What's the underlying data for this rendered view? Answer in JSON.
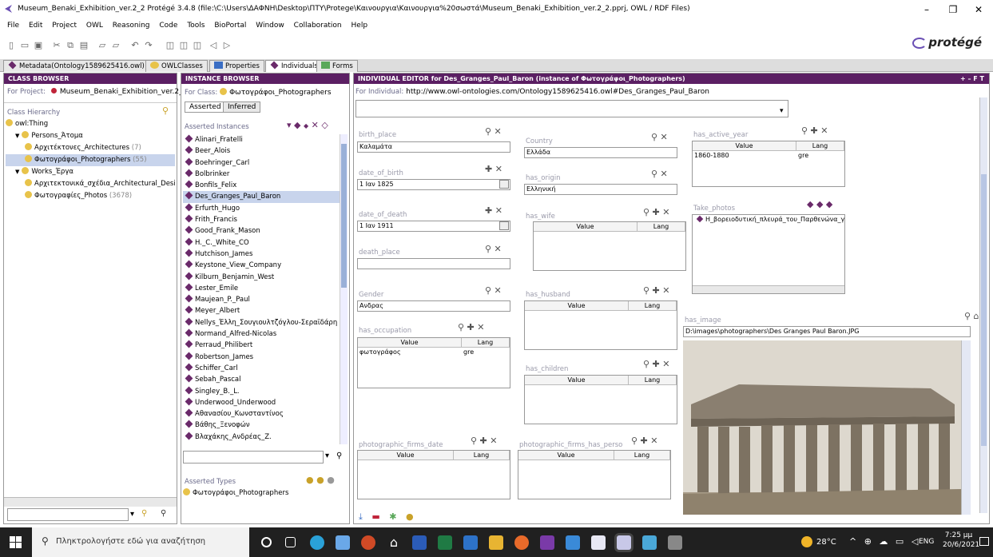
{
  "window": {
    "title": "Museum_Benaki_Exhibition_ver.2_2  Protégé 3.4.8   (file:\\C:\\Users\\ΔΑΦΝΗ\\Desktop\\ΠΤΥ\\Protege\\Καινουργια\\Καινουργια%20σωστά\\Museum_Benaki_Exhibition_ver.2_2.pprj, OWL / RDF Files)",
    "minimize": "–",
    "maximize": "❐",
    "close": "✕"
  },
  "menu": [
    "File",
    "Edit",
    "Project",
    "OWL",
    "Reasoning",
    "Code",
    "Tools",
    "BioPortal",
    "Window",
    "Collaboration",
    "Help"
  ],
  "logo": "protégé",
  "tabs": [
    "Metadata(Ontology1589625416.owl)",
    "OWLClasses",
    "Properties",
    "Individuals",
    "Forms"
  ],
  "colors": {
    "header": "#5b1f63",
    "instance": "#6a2a6a",
    "class": "#e8c34a",
    "selected": "#c8d4ec",
    "accent": "#6a4fb4"
  },
  "class_browser": {
    "header": "CLASS BROWSER",
    "project_label": "For Project:",
    "project": "Museum_Benaki_Exhibition_ver.2_2",
    "hierarchy_label": "Class Hierarchy",
    "tree": [
      {
        "label": "owl:Thing",
        "indent": 0
      },
      {
        "label": "Persons_Άτομα",
        "indent": 1,
        "arrow": "▼"
      },
      {
        "label": "Αρχιτέκτονες_Architectures",
        "count": "(7)",
        "indent": 2
      },
      {
        "label": "Φωτογράφοι_Photographers",
        "count": "(55)",
        "indent": 2,
        "selected": true
      },
      {
        "label": "Works_Έργα",
        "indent": 1,
        "arrow": "▼"
      },
      {
        "label": "Αρχιτεκτονικά_σχέδια_Architectural_Design",
        "indent": 2
      },
      {
        "label": "Φωτογραφίες_Photos",
        "count": "(3678)",
        "indent": 2
      }
    ]
  },
  "instance_browser": {
    "header": "INSTANCE BROWSER",
    "class_label": "For Class:",
    "class": "Φωτογράφοι_Photographers",
    "tab_asserted": "Asserted",
    "tab_inferred": "Inferred",
    "list_label": "Asserted Instances",
    "types_label": "Asserted Types",
    "type": "Φωτογράφοι_Photographers",
    "instances": [
      "Alinari_Fratelli",
      "Beer_Alois",
      "Boehringer_Carl",
      "Bolbrinker",
      "Bonfils_Felix",
      "Des_Granges_Paul_Baron",
      "Erfurth_Hugo",
      "Frith_Francis",
      "Good_Frank_Mason",
      "H._C._White_CO",
      "Hutchison_James",
      "Keystone_View_Company",
      "Kilburn_Benjamin_West",
      "Lester_Emile",
      "Maujean_P._Paul",
      "Meyer_Albert",
      "Nellys_Έλλη_Σουγιουλτζόγλου-Σεραϊδάρη",
      "Normand_Alfred-Nicolas",
      "Perraud_Philibert",
      "Robertson_James",
      "Schiffer_Carl",
      "Sebah_Pascal",
      "Singley_B._L.",
      "Underwood_Underwood",
      "Αθανασίου_Κωνσταντίνος",
      "Βάθης_Ξενοφών",
      "Βλαχάκης_Ανδρέας_Ζ."
    ],
    "selected_index": 5
  },
  "editor": {
    "header": "INDIVIDUAL EDITOR for Des_Granges_Paul_Baron   (instance of Φωτογράφοι_Photographers)",
    "header_controls": "+ – F T",
    "for_label": "For Individual:",
    "uri": "http://www.owl-ontologies.com/Ontology1589625416.owl#Des_Granges_Paul_Baron",
    "birth_place": {
      "label": "birth_place",
      "value": "Καλαμάτα"
    },
    "date_of_birth": {
      "label": "date_of_birth",
      "value": "1 Ιαν 1825"
    },
    "date_of_death": {
      "label": "date_of_death",
      "value": "1 Ιαν 1911"
    },
    "death_place": {
      "label": "death_place",
      "value": ""
    },
    "gender": {
      "label": "Gender",
      "value": "Ανδρας"
    },
    "has_occupation": {
      "label": "has_occupation",
      "value": "φωτογράφος",
      "lang": "gre"
    },
    "country": {
      "label": "Country",
      "value": "Ελλάδα"
    },
    "has_origin": {
      "label": "has_origin",
      "value": "Ελληνική"
    },
    "has_wife": {
      "label": "has_wife"
    },
    "has_husband": {
      "label": "has_husband"
    },
    "has_children": {
      "label": "has_children"
    },
    "photographic_firms_date": {
      "label": "photographic_firms_date"
    },
    "photographic_firms_has_person": {
      "label": "photographic_firms_has_perso"
    },
    "has_active_year": {
      "label": "has_active_year",
      "value": "1860-1880",
      "lang": "gre"
    },
    "take_photos": {
      "label": "Take_photos",
      "value": "Η_βορειοδυτική_πλευρά_του_Παρθενώνα_γύρω"
    },
    "has_image": {
      "label": "has_image",
      "value": "D:\\images\\photographers\\Des Granges Paul Baron.JPG"
    },
    "col_value": "Value",
    "col_lang": "Lang"
  },
  "taskbar": {
    "search": "Πληκτρολογήστε εδώ για αναζήτηση",
    "weather": "28°C",
    "lang": "ENG",
    "time": "7:25 μμ",
    "date": "20/6/2021"
  }
}
